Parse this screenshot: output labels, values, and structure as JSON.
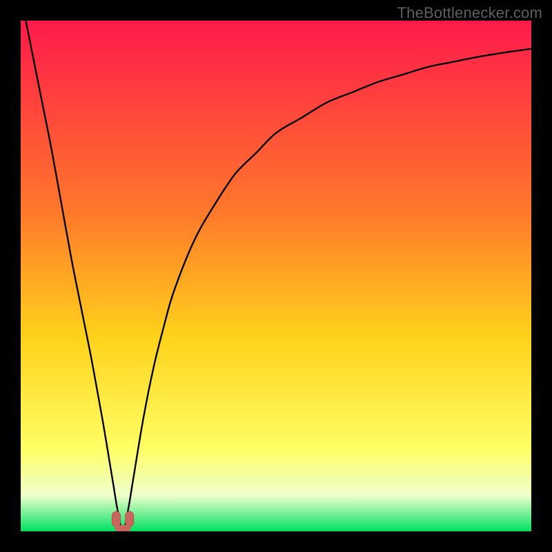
{
  "watermark": "TheBottlenecker.com",
  "colors": {
    "frame": "#000000",
    "gradient_top": "#ff1a4b",
    "gradient_mid_upper": "#ff7a2a",
    "gradient_mid": "#ffd21a",
    "gradient_low": "#ffff66",
    "gradient_pale": "#eeffcc",
    "gradient_bottom": "#00e060",
    "curve": "#000000",
    "marker_fill": "#c9675f",
    "marker_stroke": "#b2574f"
  },
  "chart_data": {
    "type": "line",
    "title": "",
    "xlabel": "",
    "ylabel": "",
    "xlim": [
      0,
      100
    ],
    "ylim": [
      0,
      100
    ],
    "optimum_x": 20,
    "series": [
      {
        "name": "bottleneck-curve",
        "x": [
          1,
          2,
          4,
          6,
          8,
          10,
          12,
          14,
          16,
          18,
          19,
          20,
          21,
          22,
          24,
          26,
          28,
          30,
          34,
          38,
          42,
          46,
          50,
          55,
          60,
          65,
          70,
          75,
          80,
          85,
          90,
          95,
          100
        ],
        "y": [
          100,
          95,
          85,
          75,
          64,
          53,
          43,
          33,
          22,
          10,
          4,
          0,
          4,
          10,
          22,
          32,
          40,
          47,
          57,
          64,
          70,
          74,
          78,
          81,
          84,
          86,
          88,
          89.5,
          91,
          92,
          93,
          93.8,
          94.5
        ]
      }
    ],
    "markers": [
      {
        "x": 18.7,
        "y": 2.0
      },
      {
        "x": 21.3,
        "y": 2.0
      }
    ],
    "gradient_stops": [
      {
        "pct": 0,
        "color_key": "gradient_top"
      },
      {
        "pct": 38,
        "color_key": "gradient_mid_upper"
      },
      {
        "pct": 62,
        "color_key": "gradient_mid"
      },
      {
        "pct": 84,
        "color_key": "gradient_low"
      },
      {
        "pct": 93,
        "color_key": "gradient_pale"
      },
      {
        "pct": 100,
        "color_key": "gradient_bottom"
      }
    ]
  }
}
